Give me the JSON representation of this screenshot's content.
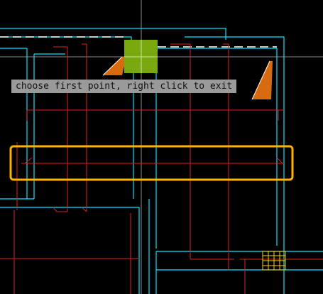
{
  "canvas": {
    "background": "#000000",
    "wall_color": "#00e5ff",
    "dim_color": "#e02020",
    "crosshair_color": "#ffffff",
    "highlight_color": "#ffb000",
    "selected_block_color": "#7aa80f",
    "hatch_color": "#ffd000",
    "arrow_fill_color": "#d86a10"
  },
  "prompt": {
    "text": "choose first point, right click to exit"
  }
}
